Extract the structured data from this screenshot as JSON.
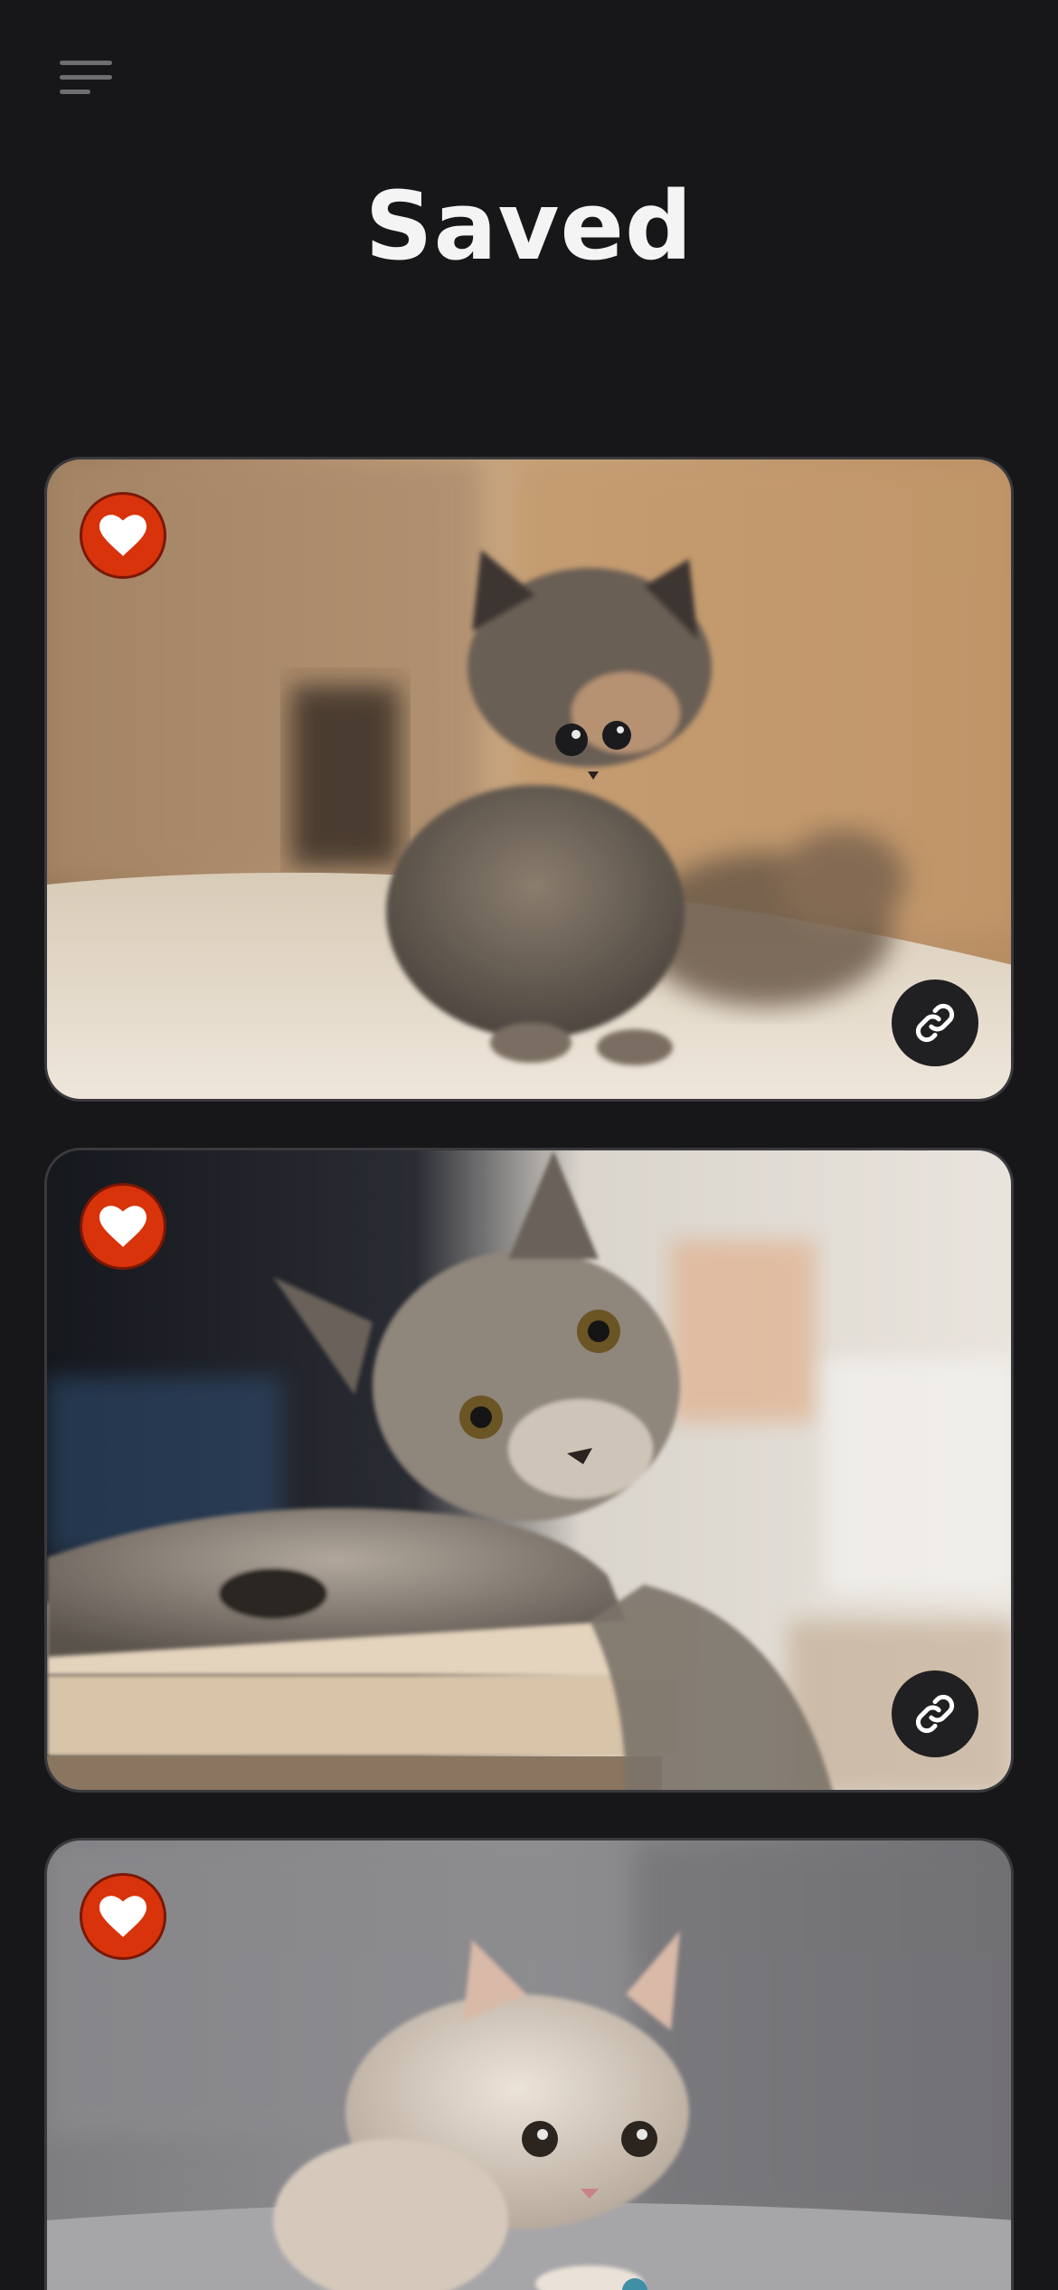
{
  "header": {
    "menu_icon": "hamburger-menu-icon",
    "title": "Saved"
  },
  "cards": [
    {
      "subject": "tabby-kittens-on-couch",
      "liked": true,
      "heart_icon": "heart-icon",
      "link_icon": "link-icon",
      "colors": {
        "background": "#c9a680",
        "floor": "#e6dccd",
        "cat": "#6f655a"
      }
    },
    {
      "subject": "tabby-kitten-on-table",
      "liked": true,
      "heart_icon": "heart-icon",
      "link_icon": "link-icon",
      "colors": {
        "background": "#dcd6cc",
        "table": "#e9dccb",
        "cat": "#8a8178"
      }
    },
    {
      "subject": "cream-kitten-on-grey-sofa",
      "liked": true,
      "heart_icon": "heart-icon",
      "link_icon": "link-icon",
      "colors": {
        "background": "#8c8b8e",
        "sofa": "#9d9c9f",
        "cat": "#dcd0c3"
      }
    }
  ],
  "colors": {
    "app_background": "#17171a",
    "heart_accent": "#d8330b",
    "link_button": "#202022",
    "title": "#f4f4f4"
  }
}
